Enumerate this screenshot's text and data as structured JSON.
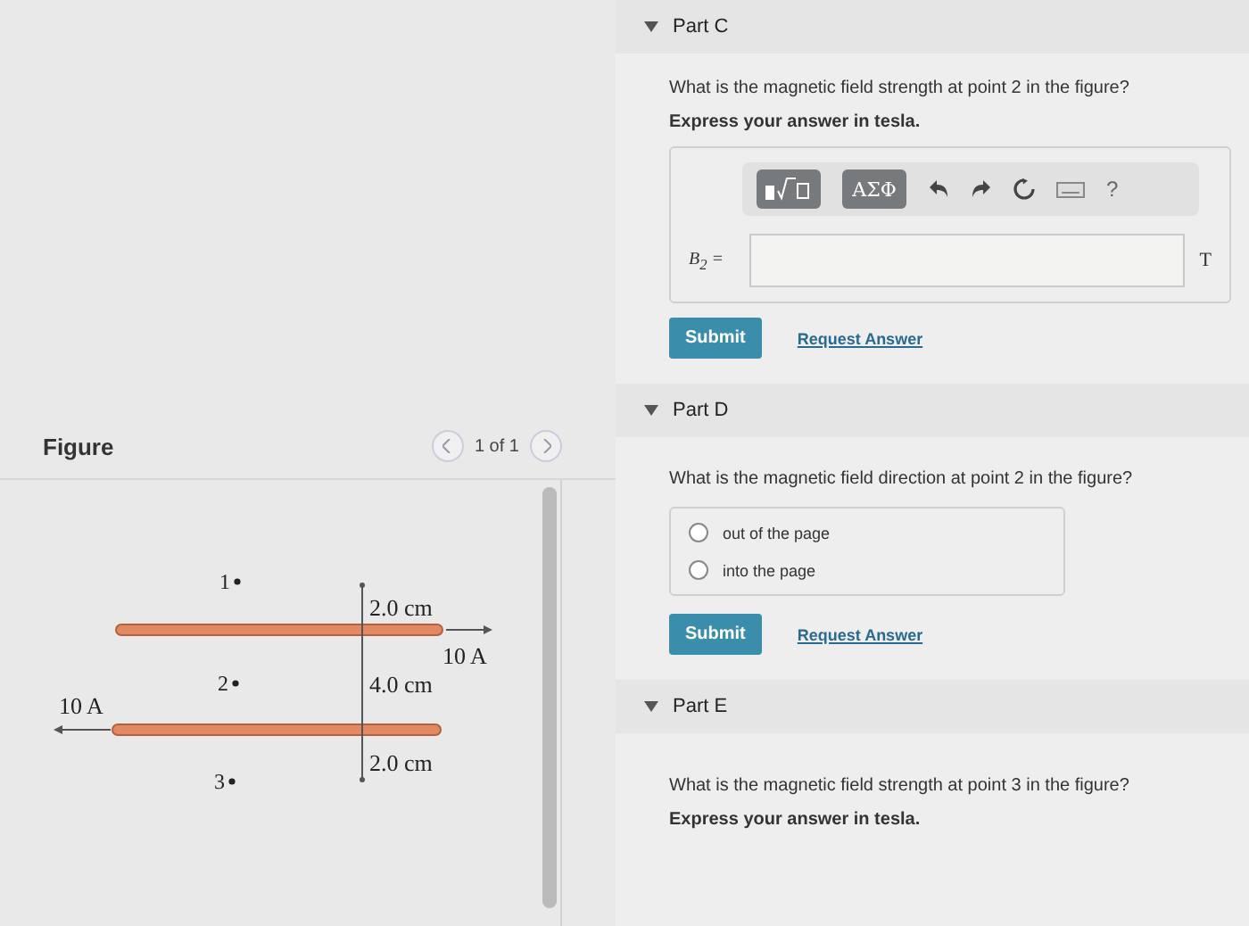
{
  "figure_panel": {
    "title": "Figure",
    "pager": "1 of 1",
    "points": [
      "1",
      "2",
      "3"
    ],
    "distances": [
      "2.0 cm",
      "4.0 cm",
      "2.0 cm"
    ],
    "currents": [
      "10 A",
      "10 A"
    ]
  },
  "parts": [
    {
      "kind": "numeric",
      "title": "Part C",
      "expanded": true,
      "question": "What is the magnetic field strength at point 2 in the figure?",
      "instruction": "Express your answer in tesla.",
      "toolbar": [
        "ΑΣΦ",
        "?"
      ],
      "variable": "B$_{2}$ =",
      "unit": "T",
      "submit": "Submit",
      "request": "Request Answer"
    },
    {
      "kind": "choice",
      "title": "Part D",
      "expanded": true,
      "question": "What is the magnetic field direction at point 2 in the figure?",
      "options": [
        {
          "label": "out of the page",
          "selected": false
        },
        {
          "label": "into the page",
          "selected": false
        }
      ],
      "submit": "Submit",
      "request": "Request Answer"
    },
    {
      "kind": "prompt",
      "title": "Part E",
      "expanded": true,
      "question": "What is the magnetic field strength at point 3 in the figure?",
      "instruction": "Express your answer in tesla."
    }
  ]
}
